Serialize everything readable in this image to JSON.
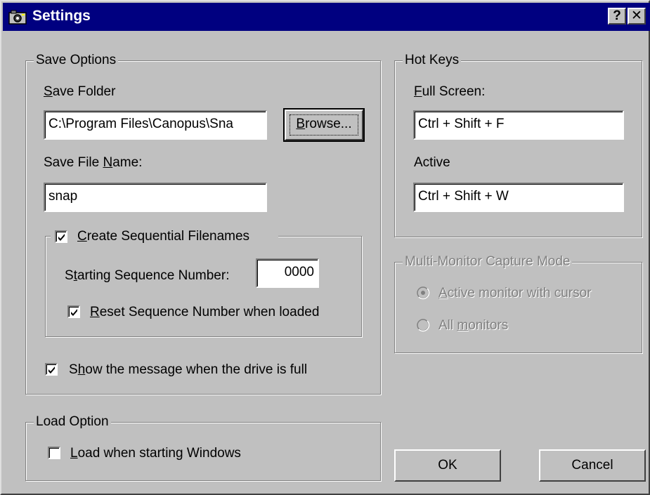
{
  "window": {
    "title": "Settings",
    "help_button": "?",
    "close_button": "✕",
    "icon": "camera-icon"
  },
  "save_options": {
    "group_label": "Save Options",
    "save_folder_label": {
      "pre": "",
      "key": "S",
      "post": "ave Folder"
    },
    "save_folder_value": "C:\\Program Files\\Canopus\\Sna",
    "browse_button": {
      "pre": "",
      "key": "B",
      "post": "rowse..."
    },
    "save_file_name_label": {
      "pre": "Save File ",
      "key": "N",
      "post": "ame:"
    },
    "save_file_name_value": "snap",
    "sequential": {
      "group_label": {
        "pre": "",
        "key": "C",
        "post": "reate Sequential Filenames"
      },
      "checked": true,
      "starting_label": {
        "pre": "S",
        "key": "t",
        "post": "arting Sequence Number:"
      },
      "starting_value": "0000",
      "reset_label": {
        "pre": "",
        "key": "R",
        "post": "eset Sequence Number when loaded"
      },
      "reset_checked": true
    },
    "show_message": {
      "pre": "S",
      "key": "h",
      "post": "ow the message when the drive is full"
    },
    "show_message_checked": true
  },
  "load_option": {
    "group_label": "Load Option",
    "load_label": {
      "pre": "",
      "key": "L",
      "post": "oad when starting Windows"
    },
    "load_checked": false
  },
  "hot_keys": {
    "group_label": "Hot Keys",
    "full_screen_label": {
      "pre": "",
      "key": "F",
      "post": "ull Screen:"
    },
    "full_screen_value": "Ctrl + Shift + F",
    "active_label": "Active",
    "active_value": "Ctrl + Shift + W"
  },
  "multi_monitor": {
    "group_label": "Multi-Monitor Capture Mode",
    "option_active": {
      "pre": "",
      "key": "A",
      "post": "ctive monitor with cursor"
    },
    "option_all": {
      "pre": "All ",
      "key": "m",
      "post": "onitors"
    },
    "selected": "active",
    "enabled": false
  },
  "buttons": {
    "ok": "OK",
    "cancel": "Cancel"
  },
  "colors": {
    "face": "#c0c0c0",
    "titlebar": "#000080",
    "shadow": "#808080",
    "highlight": "#ffffff"
  }
}
